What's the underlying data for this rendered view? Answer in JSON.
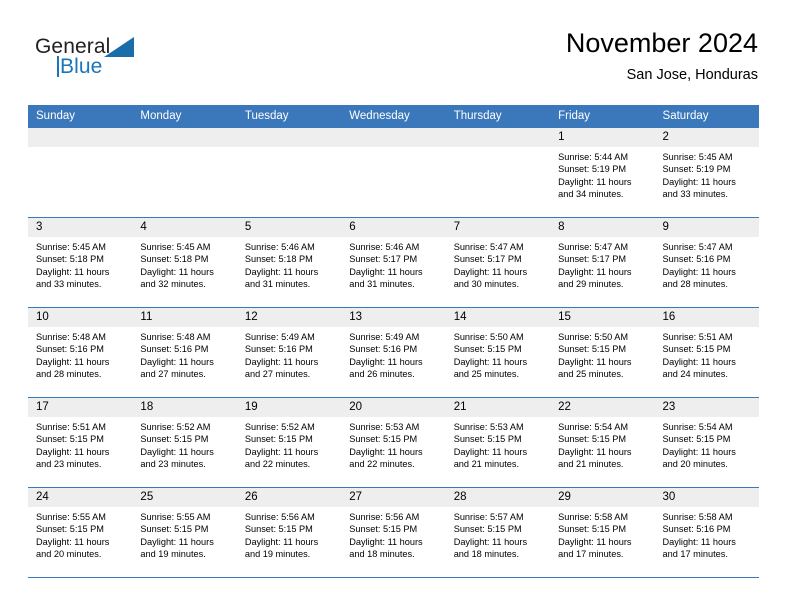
{
  "brand": {
    "name_part1": "General",
    "name_part2": "Blue",
    "logo_icon": "blue-triangle-logo"
  },
  "header": {
    "title": "November 2024",
    "subtitle": "San Jose, Honduras"
  },
  "weekdays": [
    "Sunday",
    "Monday",
    "Tuesday",
    "Wednesday",
    "Thursday",
    "Friday",
    "Saturday"
  ],
  "colors": {
    "header_blue": "#3a78bb",
    "daynum_gray": "#eeeeee",
    "brand_blue": "#1b75bb",
    "text": "#000000"
  },
  "weeks": [
    [
      {
        "number": "",
        "sunrise": "",
        "sunset": "",
        "daylight_line1": "",
        "daylight_line2": "",
        "blank": true
      },
      {
        "number": "",
        "sunrise": "",
        "sunset": "",
        "daylight_line1": "",
        "daylight_line2": "",
        "blank": true
      },
      {
        "number": "",
        "sunrise": "",
        "sunset": "",
        "daylight_line1": "",
        "daylight_line2": "",
        "blank": true
      },
      {
        "number": "",
        "sunrise": "",
        "sunset": "",
        "daylight_line1": "",
        "daylight_line2": "",
        "blank": true
      },
      {
        "number": "",
        "sunrise": "",
        "sunset": "",
        "daylight_line1": "",
        "daylight_line2": "",
        "blank": true
      },
      {
        "number": "1",
        "sunrise": "Sunrise: 5:44 AM",
        "sunset": "Sunset: 5:19 PM",
        "daylight_line1": "Daylight: 11 hours",
        "daylight_line2": "and 34 minutes."
      },
      {
        "number": "2",
        "sunrise": "Sunrise: 5:45 AM",
        "sunset": "Sunset: 5:19 PM",
        "daylight_line1": "Daylight: 11 hours",
        "daylight_line2": "and 33 minutes."
      }
    ],
    [
      {
        "number": "3",
        "sunrise": "Sunrise: 5:45 AM",
        "sunset": "Sunset: 5:18 PM",
        "daylight_line1": "Daylight: 11 hours",
        "daylight_line2": "and 33 minutes."
      },
      {
        "number": "4",
        "sunrise": "Sunrise: 5:45 AM",
        "sunset": "Sunset: 5:18 PM",
        "daylight_line1": "Daylight: 11 hours",
        "daylight_line2": "and 32 minutes."
      },
      {
        "number": "5",
        "sunrise": "Sunrise: 5:46 AM",
        "sunset": "Sunset: 5:18 PM",
        "daylight_line1": "Daylight: 11 hours",
        "daylight_line2": "and 31 minutes."
      },
      {
        "number": "6",
        "sunrise": "Sunrise: 5:46 AM",
        "sunset": "Sunset: 5:17 PM",
        "daylight_line1": "Daylight: 11 hours",
        "daylight_line2": "and 31 minutes."
      },
      {
        "number": "7",
        "sunrise": "Sunrise: 5:47 AM",
        "sunset": "Sunset: 5:17 PM",
        "daylight_line1": "Daylight: 11 hours",
        "daylight_line2": "and 30 minutes."
      },
      {
        "number": "8",
        "sunrise": "Sunrise: 5:47 AM",
        "sunset": "Sunset: 5:17 PM",
        "daylight_line1": "Daylight: 11 hours",
        "daylight_line2": "and 29 minutes."
      },
      {
        "number": "9",
        "sunrise": "Sunrise: 5:47 AM",
        "sunset": "Sunset: 5:16 PM",
        "daylight_line1": "Daylight: 11 hours",
        "daylight_line2": "and 28 minutes."
      }
    ],
    [
      {
        "number": "10",
        "sunrise": "Sunrise: 5:48 AM",
        "sunset": "Sunset: 5:16 PM",
        "daylight_line1": "Daylight: 11 hours",
        "daylight_line2": "and 28 minutes."
      },
      {
        "number": "11",
        "sunrise": "Sunrise: 5:48 AM",
        "sunset": "Sunset: 5:16 PM",
        "daylight_line1": "Daylight: 11 hours",
        "daylight_line2": "and 27 minutes."
      },
      {
        "number": "12",
        "sunrise": "Sunrise: 5:49 AM",
        "sunset": "Sunset: 5:16 PM",
        "daylight_line1": "Daylight: 11 hours",
        "daylight_line2": "and 27 minutes."
      },
      {
        "number": "13",
        "sunrise": "Sunrise: 5:49 AM",
        "sunset": "Sunset: 5:16 PM",
        "daylight_line1": "Daylight: 11 hours",
        "daylight_line2": "and 26 minutes."
      },
      {
        "number": "14",
        "sunrise": "Sunrise: 5:50 AM",
        "sunset": "Sunset: 5:15 PM",
        "daylight_line1": "Daylight: 11 hours",
        "daylight_line2": "and 25 minutes."
      },
      {
        "number": "15",
        "sunrise": "Sunrise: 5:50 AM",
        "sunset": "Sunset: 5:15 PM",
        "daylight_line1": "Daylight: 11 hours",
        "daylight_line2": "and 25 minutes."
      },
      {
        "number": "16",
        "sunrise": "Sunrise: 5:51 AM",
        "sunset": "Sunset: 5:15 PM",
        "daylight_line1": "Daylight: 11 hours",
        "daylight_line2": "and 24 minutes."
      }
    ],
    [
      {
        "number": "17",
        "sunrise": "Sunrise: 5:51 AM",
        "sunset": "Sunset: 5:15 PM",
        "daylight_line1": "Daylight: 11 hours",
        "daylight_line2": "and 23 minutes."
      },
      {
        "number": "18",
        "sunrise": "Sunrise: 5:52 AM",
        "sunset": "Sunset: 5:15 PM",
        "daylight_line1": "Daylight: 11 hours",
        "daylight_line2": "and 23 minutes."
      },
      {
        "number": "19",
        "sunrise": "Sunrise: 5:52 AM",
        "sunset": "Sunset: 5:15 PM",
        "daylight_line1": "Daylight: 11 hours",
        "daylight_line2": "and 22 minutes."
      },
      {
        "number": "20",
        "sunrise": "Sunrise: 5:53 AM",
        "sunset": "Sunset: 5:15 PM",
        "daylight_line1": "Daylight: 11 hours",
        "daylight_line2": "and 22 minutes."
      },
      {
        "number": "21",
        "sunrise": "Sunrise: 5:53 AM",
        "sunset": "Sunset: 5:15 PM",
        "daylight_line1": "Daylight: 11 hours",
        "daylight_line2": "and 21 minutes."
      },
      {
        "number": "22",
        "sunrise": "Sunrise: 5:54 AM",
        "sunset": "Sunset: 5:15 PM",
        "daylight_line1": "Daylight: 11 hours",
        "daylight_line2": "and 21 minutes."
      },
      {
        "number": "23",
        "sunrise": "Sunrise: 5:54 AM",
        "sunset": "Sunset: 5:15 PM",
        "daylight_line1": "Daylight: 11 hours",
        "daylight_line2": "and 20 minutes."
      }
    ],
    [
      {
        "number": "24",
        "sunrise": "Sunrise: 5:55 AM",
        "sunset": "Sunset: 5:15 PM",
        "daylight_line1": "Daylight: 11 hours",
        "daylight_line2": "and 20 minutes."
      },
      {
        "number": "25",
        "sunrise": "Sunrise: 5:55 AM",
        "sunset": "Sunset: 5:15 PM",
        "daylight_line1": "Daylight: 11 hours",
        "daylight_line2": "and 19 minutes."
      },
      {
        "number": "26",
        "sunrise": "Sunrise: 5:56 AM",
        "sunset": "Sunset: 5:15 PM",
        "daylight_line1": "Daylight: 11 hours",
        "daylight_line2": "and 19 minutes."
      },
      {
        "number": "27",
        "sunrise": "Sunrise: 5:56 AM",
        "sunset": "Sunset: 5:15 PM",
        "daylight_line1": "Daylight: 11 hours",
        "daylight_line2": "and 18 minutes."
      },
      {
        "number": "28",
        "sunrise": "Sunrise: 5:57 AM",
        "sunset": "Sunset: 5:15 PM",
        "daylight_line1": "Daylight: 11 hours",
        "daylight_line2": "and 18 minutes."
      },
      {
        "number": "29",
        "sunrise": "Sunrise: 5:58 AM",
        "sunset": "Sunset: 5:15 PM",
        "daylight_line1": "Daylight: 11 hours",
        "daylight_line2": "and 17 minutes."
      },
      {
        "number": "30",
        "sunrise": "Sunrise: 5:58 AM",
        "sunset": "Sunset: 5:16 PM",
        "daylight_line1": "Daylight: 11 hours",
        "daylight_line2": "and 17 minutes."
      }
    ]
  ]
}
